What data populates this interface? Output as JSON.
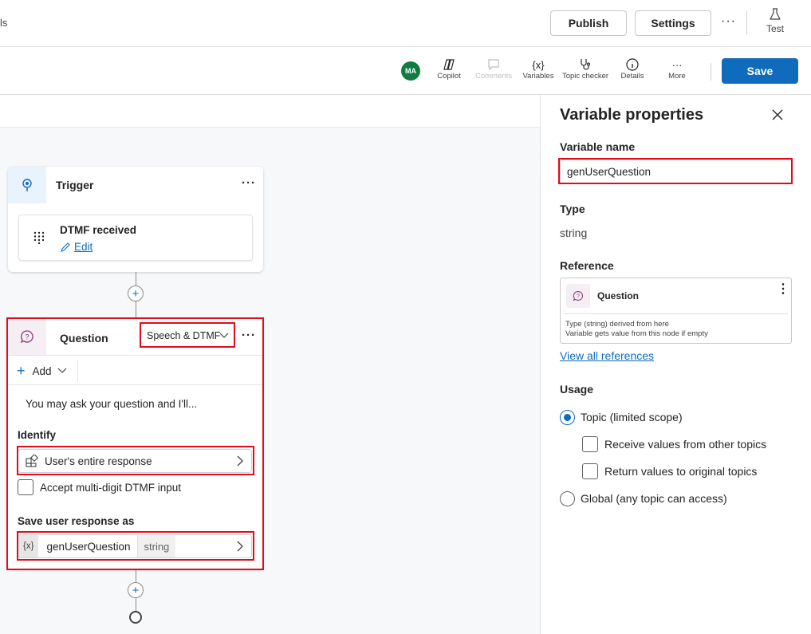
{
  "header": {
    "breadcrumb_fragment": "ls",
    "publish_label": "Publish",
    "settings_label": "Settings",
    "more_label": "···",
    "test_label": "Test"
  },
  "toolbar": {
    "avatar_initials": "MA",
    "items": [
      {
        "label": "Copilot",
        "icon": "copilot-icon",
        "enabled": true
      },
      {
        "label": "Comments",
        "icon": "comment-icon",
        "enabled": false
      },
      {
        "label": "Variables",
        "icon": "variables-icon",
        "enabled": true
      },
      {
        "label": "Topic checker",
        "icon": "stethoscope-icon",
        "enabled": true
      },
      {
        "label": "Details",
        "icon": "info-icon",
        "enabled": true
      },
      {
        "label": "More",
        "icon": "more-icon",
        "enabled": true
      }
    ],
    "save_label": "Save"
  },
  "canvas": {
    "trigger": {
      "title": "Trigger",
      "event_title": "DTMF received",
      "edit_label": "Edit"
    },
    "question": {
      "title": "Question",
      "mode_label": "Speech & DTMF",
      "add_label": "Add",
      "message": "You may ask your question and I'll...",
      "identify_label": "Identify",
      "identify_value": "User's entire response",
      "multidigit_label": "Accept multi-digit DTMF input",
      "save_as_label": "Save user response as",
      "var_icon": "{x}",
      "var_name": "genUserQuestion",
      "var_type": "string"
    }
  },
  "panel": {
    "title": "Variable properties",
    "name_label": "Variable name",
    "name_value": "genUserQuestion",
    "type_label": "Type",
    "type_value": "string",
    "reference_label": "Reference",
    "reference": {
      "node_title": "Question",
      "line1": "Type (string) derived from here",
      "line2": "Variable gets value from this node if empty"
    },
    "view_all_label": "View all references",
    "usage_label": "Usage",
    "usage_topic": "Topic (limited scope)",
    "usage_receive": "Receive values from other topics",
    "usage_return": "Return values to original topics",
    "usage_global": "Global (any topic can access)"
  },
  "colors": {
    "accent": "#0f6cbd",
    "highlight": "#e00b1c",
    "avatar": "#107c41"
  }
}
